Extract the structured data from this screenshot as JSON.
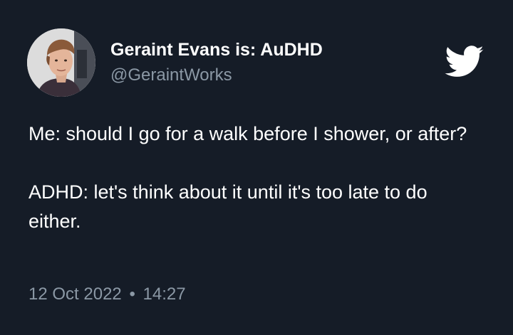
{
  "tweet": {
    "author": {
      "display_name": "Geraint Evans is: AuDHD",
      "handle": "@GeraintWorks"
    },
    "paragraphs": [
      "Me: should I go for a walk before I shower, or after?",
      "ADHD: let's think about it until it's too late to do either."
    ],
    "date": "12 Oct 2022",
    "separator": "•",
    "time": "14:27",
    "brand_icon": "twitter-bird-icon"
  },
  "colors": {
    "background": "#151c27",
    "text": "#ffffff",
    "secondary_text": "#8b98a5",
    "brand": "#ffffff"
  }
}
